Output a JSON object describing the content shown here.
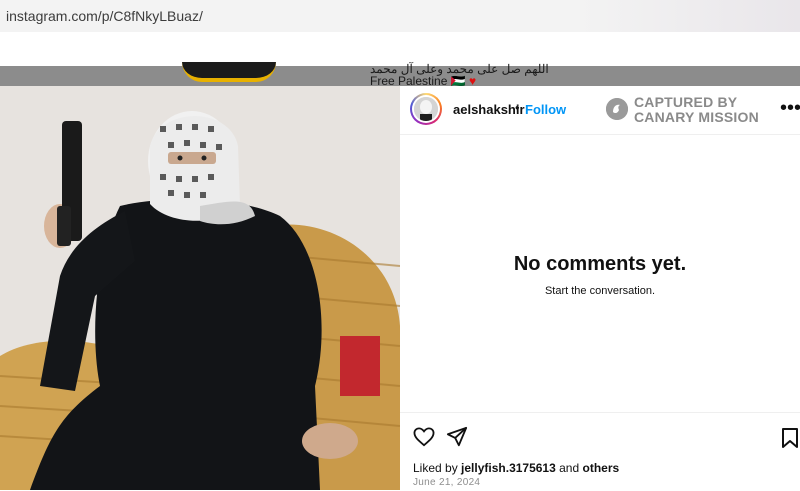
{
  "browser": {
    "url": "instagram.com/p/C8fNkyLBuaz/"
  },
  "background": {
    "arabic_text": "اللهم صل على محمد وعلى آل محمد",
    "free_palestine": "Free Palestine 🇵🇸",
    "heart": "♥"
  },
  "post": {
    "username": "aelshakshir",
    "separator": "•",
    "follow_label": "Follow",
    "watermark_line1": "CAPTURED BY",
    "watermark_line2": "CANARY MISSION",
    "more_icon": "more-horizontal-icon",
    "empty_title": "No comments yet.",
    "empty_subtitle": "Start the conversation.",
    "liked_by_prefix": "Liked by",
    "liked_by_user": "jellyfish.3175613",
    "liked_by_and": "and",
    "liked_by_others": "others",
    "date": "June 21, 2024"
  },
  "colors": {
    "follow_blue": "#0095f6",
    "watermark_gray": "#8a8a8a"
  }
}
